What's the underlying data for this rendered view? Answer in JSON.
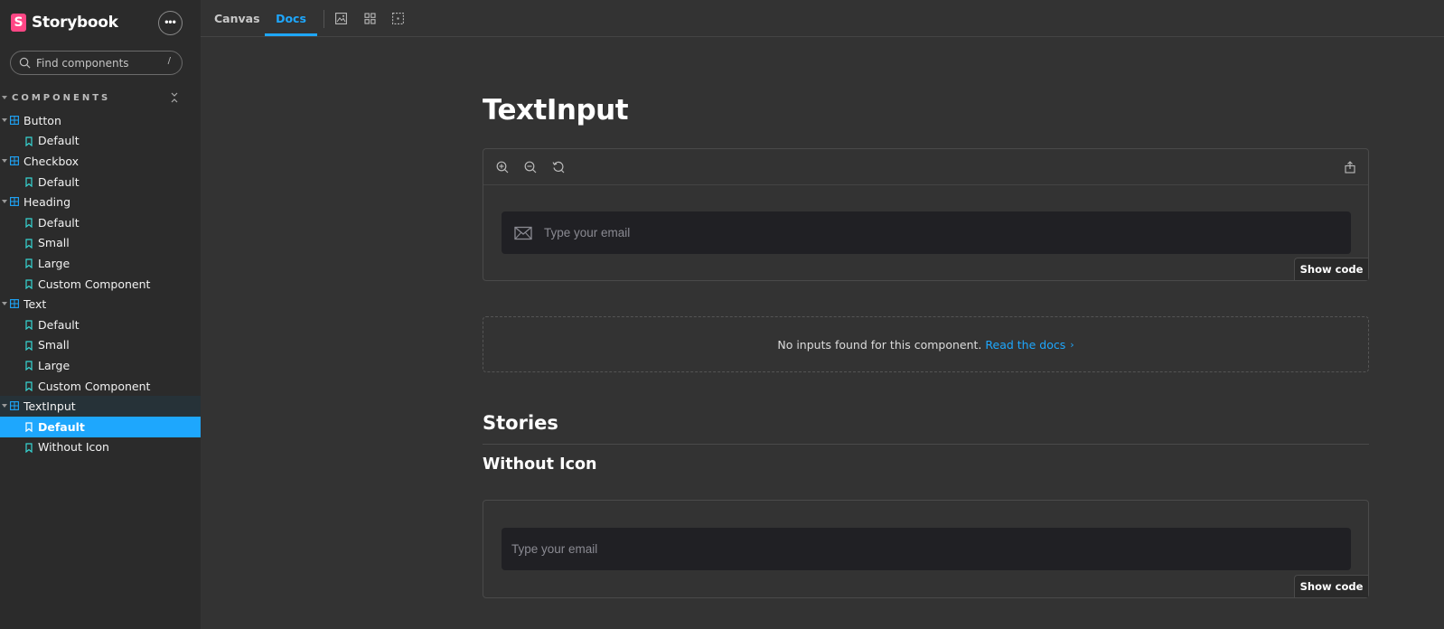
{
  "brand": {
    "name": "Storybook",
    "logo_letter": "S"
  },
  "search": {
    "placeholder": "Find components",
    "shortcut": "/"
  },
  "sidebar": {
    "section_label": "COMPONENTS",
    "tree": [
      {
        "kind": "component",
        "label": "Button"
      },
      {
        "kind": "story",
        "label": "Default"
      },
      {
        "kind": "component",
        "label": "Checkbox"
      },
      {
        "kind": "story",
        "label": "Default"
      },
      {
        "kind": "component",
        "label": "Heading"
      },
      {
        "kind": "story",
        "label": "Default"
      },
      {
        "kind": "story",
        "label": "Small"
      },
      {
        "kind": "story",
        "label": "Large"
      },
      {
        "kind": "story",
        "label": "Custom Component"
      },
      {
        "kind": "component",
        "label": "Text"
      },
      {
        "kind": "story",
        "label": "Default"
      },
      {
        "kind": "story",
        "label": "Small"
      },
      {
        "kind": "story",
        "label": "Large"
      },
      {
        "kind": "story",
        "label": "Custom Component"
      },
      {
        "kind": "component",
        "label": "TextInput"
      },
      {
        "kind": "story",
        "label": "Default"
      },
      {
        "kind": "story",
        "label": "Without Icon"
      }
    ]
  },
  "toolbar": {
    "tabs": [
      {
        "label": "Canvas"
      },
      {
        "label": "Docs"
      }
    ],
    "icons": [
      "image-icon",
      "grid-icon",
      "outline-icon"
    ]
  },
  "docs": {
    "title": "TextInput",
    "primary_preview": {
      "placeholder": "Type your email",
      "show_code": "Show code"
    },
    "no_inputs": {
      "text": "No inputs found for this component.",
      "link": "Read the docs"
    },
    "stories_heading": "Stories",
    "story_heading": "Without Icon",
    "secondary_preview": {
      "placeholder": "Type your email",
      "show_code": "Show code"
    }
  },
  "colors": {
    "accent": "#1ea7fd",
    "brand": "#ff4785",
    "background": "#333333",
    "sidebar": "#2b2b2b"
  }
}
